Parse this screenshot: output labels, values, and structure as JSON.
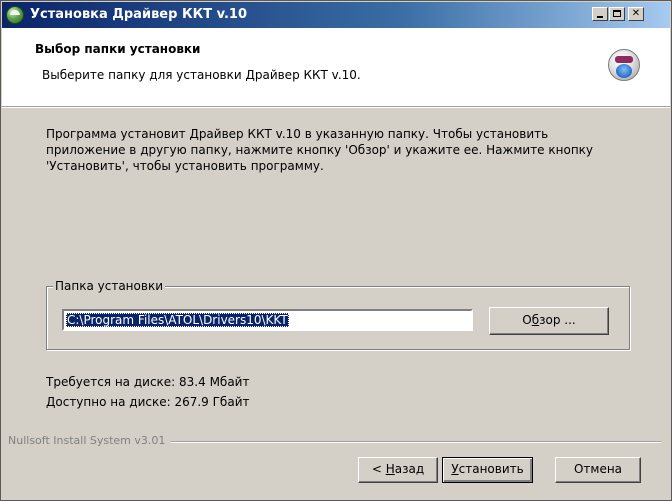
{
  "window": {
    "title": "Установка Драйвер ККТ v.10",
    "controls": {
      "minimize": "_",
      "maximize": "□",
      "close": "✕"
    }
  },
  "header": {
    "title": "Выбор папки установки",
    "subtitle": "Выберите папку для установки Драйвер ККТ v.10."
  },
  "body": {
    "description": "Программа установит Драйвер ККТ v.10 в указанную папку. Чтобы установить приложение в другую папку, нажмите кнопку 'Обзор' и укажите ее. Нажмите кнопку 'Установить', чтобы установить программу.",
    "group_label": "Папка установки",
    "install_path": "C:\\Program Files\\ATOL\\Drivers10\\KKT",
    "browse": {
      "prefix": "О",
      "mnemonic": "б",
      "suffix": "зор ..."
    },
    "space_required": "Требуется на диске: 83.4 Мбайт",
    "space_available": "Доступно на диске: 267.9 Гбайт"
  },
  "footer": {
    "branding": "Nullsoft Install System v3.01",
    "back": {
      "prefix": "< ",
      "mnemonic": "Н",
      "suffix": "азад"
    },
    "install": {
      "prefix": "",
      "mnemonic": "У",
      "suffix": "становить"
    },
    "cancel": "Отмена"
  },
  "colors": {
    "title_gradient_start": "#0a246a",
    "title_gradient_end": "#a6caf0",
    "dialog_face": "#d4d0c8",
    "selection": "#0a246a"
  },
  "icons": {
    "app": "installer-app-icon",
    "header": "installer-cd-icon"
  }
}
